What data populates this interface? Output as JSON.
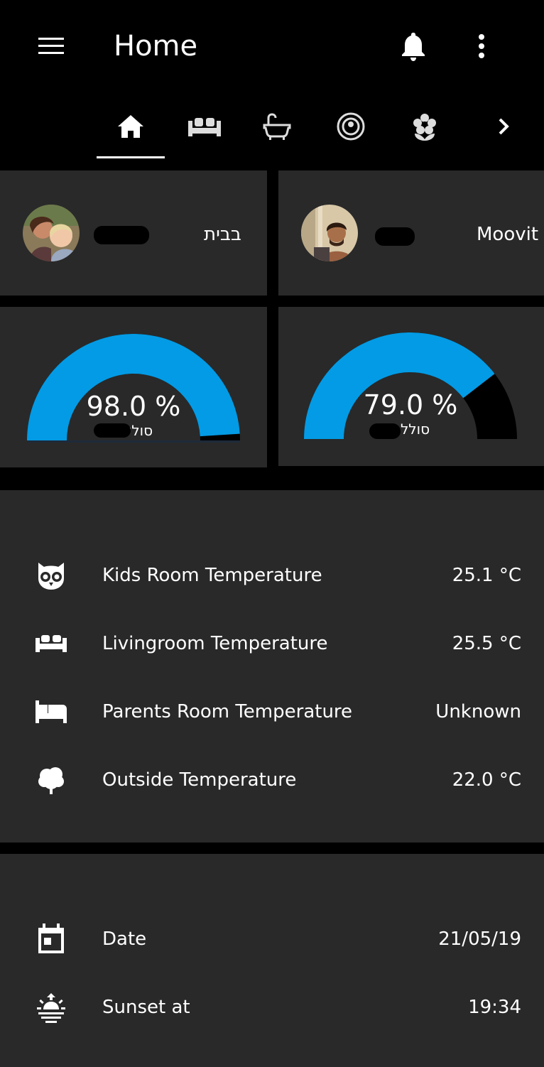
{
  "header": {
    "title": "Home",
    "menu_icon": "menu-icon",
    "notifications_icon": "bell-icon",
    "more_icon": "dots-vertical-icon"
  },
  "tabs": [
    {
      "icon": "home-icon",
      "active": true
    },
    {
      "icon": "sofa-icon",
      "active": false
    },
    {
      "icon": "bathtub-icon",
      "active": false
    },
    {
      "icon": "robot-vacuum-icon",
      "active": false
    },
    {
      "icon": "flower-icon",
      "active": false
    }
  ],
  "tabs_more_icon": "chevron-right-icon",
  "persons": [
    {
      "state": "בבית"
    },
    {
      "state": "Moovit"
    }
  ],
  "gauges": [
    {
      "value": 98.0,
      "display": "98.0 %",
      "label": "סוללה"
    },
    {
      "value": 79.0,
      "display": "79.0 %",
      "label": "סוללה"
    }
  ],
  "temperatures": [
    {
      "icon": "owl-icon",
      "name": "Kids Room Temperature",
      "value": "25.1 °C"
    },
    {
      "icon": "sofa-icon",
      "name": "Livingroom Temperature",
      "value": "25.5 °C"
    },
    {
      "icon": "bed-icon",
      "name": "Parents Room Temperature",
      "value": "Unknown"
    },
    {
      "icon": "tree-icon",
      "name": "Outside Temperature",
      "value": "22.0 °C"
    }
  ],
  "info": [
    {
      "icon": "calendar-icon",
      "name": "Date",
      "value": "21/05/19"
    },
    {
      "icon": "sunset-icon",
      "name": "Sunset at",
      "value": "19:34"
    }
  ],
  "colors": {
    "gauge_fill": "#039be5",
    "gauge_track": "#000000",
    "card_bg": "#292929",
    "page_bg": "#000000",
    "text": "#ffffff"
  }
}
